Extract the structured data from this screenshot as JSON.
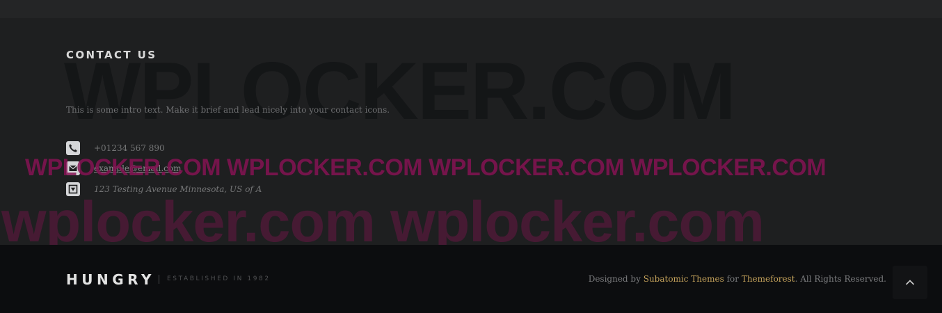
{
  "contact": {
    "heading": "CONTACT US",
    "intro": "This is some intro text. Make it brief and lead nicely into your contact icons.",
    "items": [
      {
        "icon": "phone-icon",
        "text": "+01234 567 890"
      },
      {
        "icon": "envelope-icon",
        "text": "example@email.com"
      },
      {
        "icon": "map-marker-icon",
        "text": "123 Testing Avenue Minnesota, US of A"
      }
    ]
  },
  "watermarks": {
    "large": "WPLOCKER.COM",
    "repeated": "WPLOCKER.COM WPLOCKER.COM WPLOCKER.COM WPLOCKER.COM",
    "lower": "wplocker.com wplocker.com"
  },
  "footer": {
    "brand": "HUNGRY",
    "tagline": "ESTABLISHED IN 1982",
    "credits": {
      "prefix": "Designed by ",
      "author": "Subatomic Themes",
      "middle": " for ",
      "marketplace": "Themeforest",
      "suffix": ". All Rights Reserved."
    },
    "back_to_top_icon": "chevron-up-icon"
  },
  "colors": {
    "page_background": "#1e1f20",
    "footer_background": "#0c0d0f",
    "accent_gold": "#c4a25b",
    "watermark_magenta": "#851354"
  }
}
